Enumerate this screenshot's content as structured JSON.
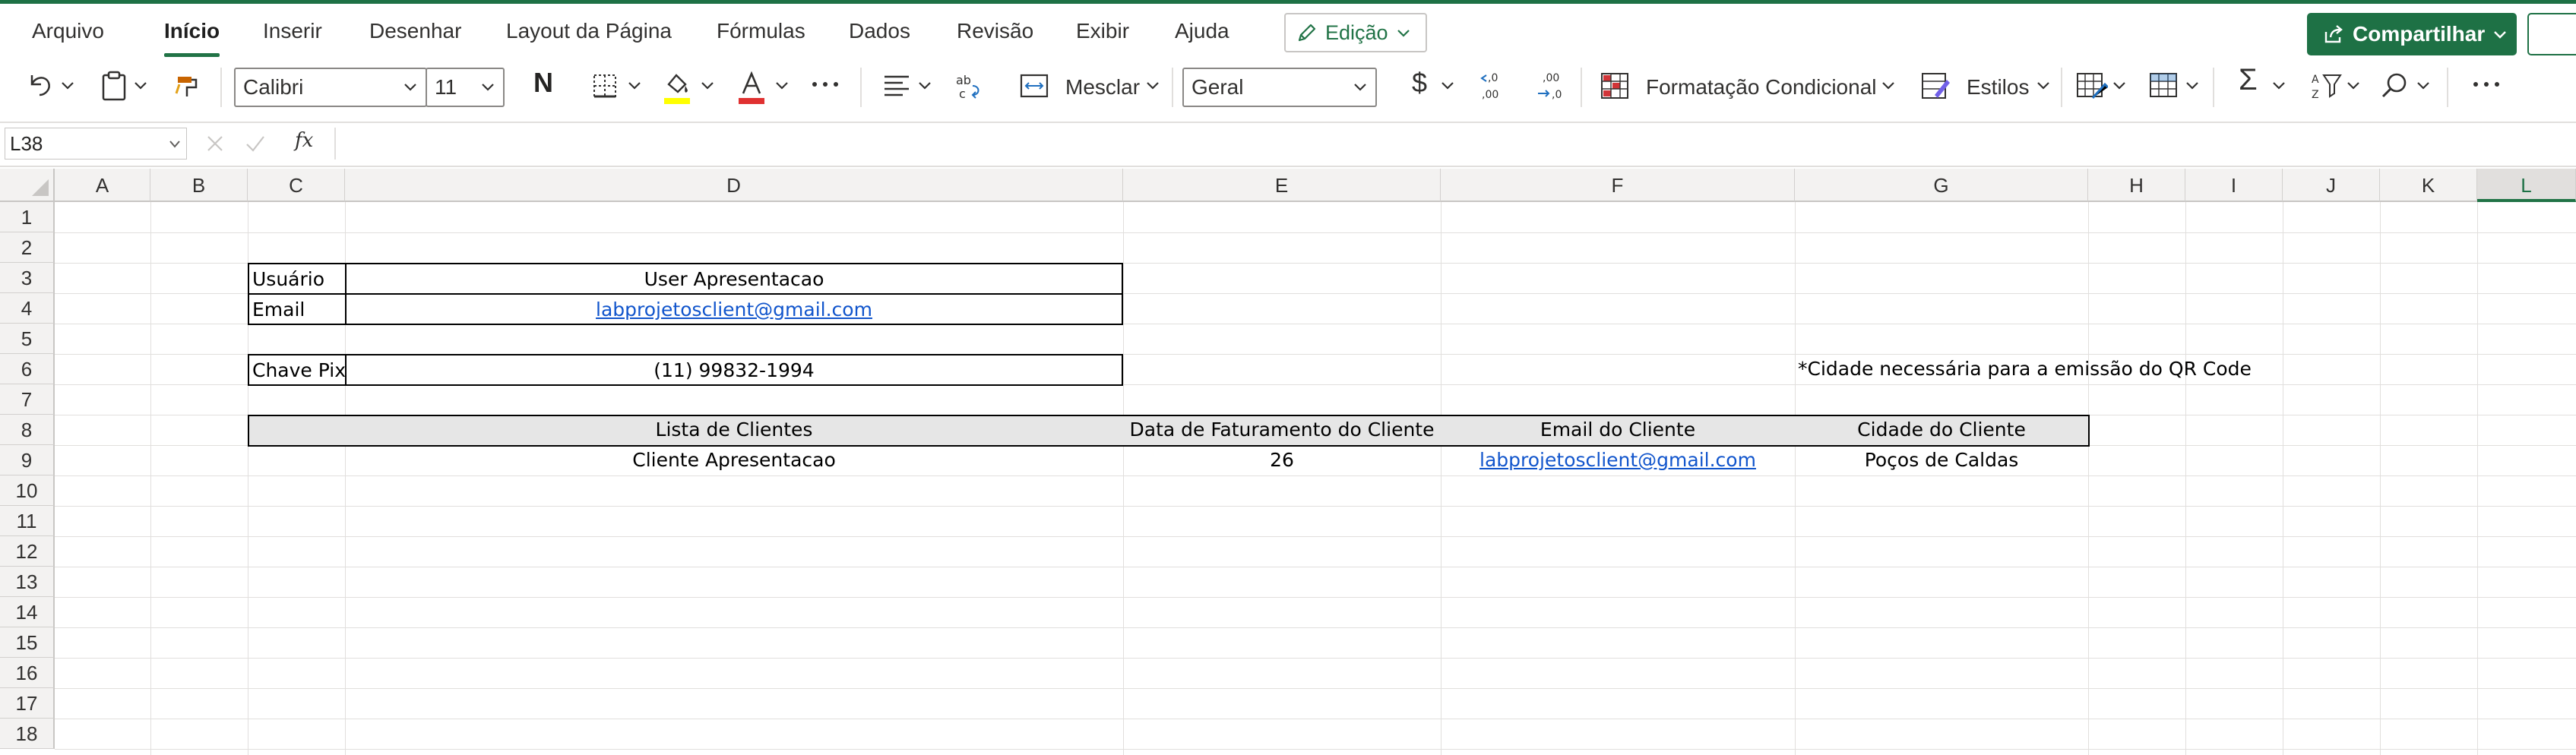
{
  "menu": {
    "tabs": [
      "Arquivo",
      "Início",
      "Inserir",
      "Desenhar",
      "Layout da Página",
      "Fórmulas",
      "Dados",
      "Revisão",
      "Exibir",
      "Ajuda"
    ],
    "edit_mode": "Edição",
    "share": "Compartilhar"
  },
  "ribbon": {
    "font_name": "Calibri",
    "font_size": "11",
    "bold_label": "N",
    "merge": "Mesclar",
    "number_format": "Geral",
    "conditional_formatting": "Formatação Condicional",
    "styles": "Estilos",
    "fill_color": "#ffff00",
    "font_color": "#e03131"
  },
  "formula_bar": {
    "name_box": "L38",
    "formula": ""
  },
  "grid": {
    "columns": [
      "A",
      "B",
      "C",
      "D",
      "E",
      "F",
      "G",
      "H",
      "I",
      "J",
      "K",
      "L"
    ],
    "selected_column": "L",
    "rows": [
      "1",
      "2",
      "3",
      "4",
      "5",
      "6",
      "7",
      "8",
      "9",
      "10",
      "11",
      "12",
      "13",
      "14",
      "15",
      "16",
      "17",
      "18"
    ]
  },
  "cells": {
    "c3": "Usuário",
    "d3": "User Apresentacao",
    "c4": "Email",
    "d4": "labprojetosclient@gmail.com",
    "c6": "Chave Pix",
    "d6": "(11) 99832-1994",
    "g6": "*Cidade necessária para a emissão do QR Code",
    "d8": "Lista de Clientes",
    "e8": "Data de Faturamento do Cliente",
    "f8": "Email do Cliente",
    "g8": "Cidade do Cliente",
    "d9": "Cliente Apresentacao",
    "e9": "26",
    "f9": "labprojetosclient@gmail.com",
    "g9": "Poços de Caldas"
  }
}
